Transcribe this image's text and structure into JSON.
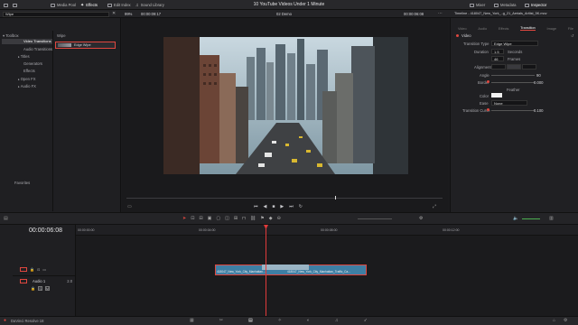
{
  "topbar": {
    "media_pool": "Media Pool",
    "effects": "Effects",
    "edit_index": "Edit Index",
    "sound_library": "Sound Library",
    "title": "10 YouTube Videos Under 1 Minute",
    "mixer": "Mixer",
    "metadata": "Metadata",
    "inspector": "Inspector"
  },
  "subbar": {
    "search_text": "Wipe",
    "zoom": "99%",
    "timecode_left": "00:00:09:17",
    "timeline_name": "02 Demo",
    "timecode_right": "00:00:06:08",
    "clip_title": "Timeline - 418047_New_York_..g_21_Aerials_Artlist_5K.mov"
  },
  "effects_tree": {
    "toolbox": "Toolbox",
    "items": [
      "Video Transitions",
      "Audio Transitions",
      "Titles",
      "Generators",
      "Effects",
      "Open FX",
      "Audio FX"
    ],
    "favorites": "Favorites",
    "category": "Wipe",
    "effect_name": "Edge Wipe"
  },
  "inspector": {
    "tabs": [
      "Video",
      "Audio",
      "Effects",
      "Transition",
      "Image",
      "File"
    ],
    "section": "Video",
    "transition_type_label": "Transition Type",
    "transition_type_value": "Edge Wipe",
    "duration_label": "Duration",
    "duration_seconds": "1.5",
    "seconds_label": "Seconds",
    "duration_frames": "46",
    "frames_label": "Frames",
    "alignment_label": "Alignment",
    "angle_label": "Angle",
    "angle_value": "90",
    "border_label": "Border",
    "border_value": "0.000",
    "feather_label": "Feather",
    "color_label": "Color",
    "ease_label": "Ease",
    "ease_value": "None",
    "curve_label": "Transition Curve",
    "curve_value": "0.100"
  },
  "timeline": {
    "timecode": "00:00:06:08",
    "ruler": [
      "00:00:00:00",
      "00:00:04:00",
      "00:00:08:00",
      "00:00:12:00"
    ],
    "audio_track": "Audio 1",
    "audio_channel": "2.0",
    "clip1": "418047_New_York_City_Manhattan...",
    "clip2": "418047_New_York_City_Manhattan_Traffic_Ca..."
  },
  "bottombar": {
    "app_name": "DaVinci Resolve 18"
  },
  "colors": {
    "accent": "#e0473f",
    "clip_blue": "#3e7ea3",
    "playhead": "#e03a3a"
  }
}
